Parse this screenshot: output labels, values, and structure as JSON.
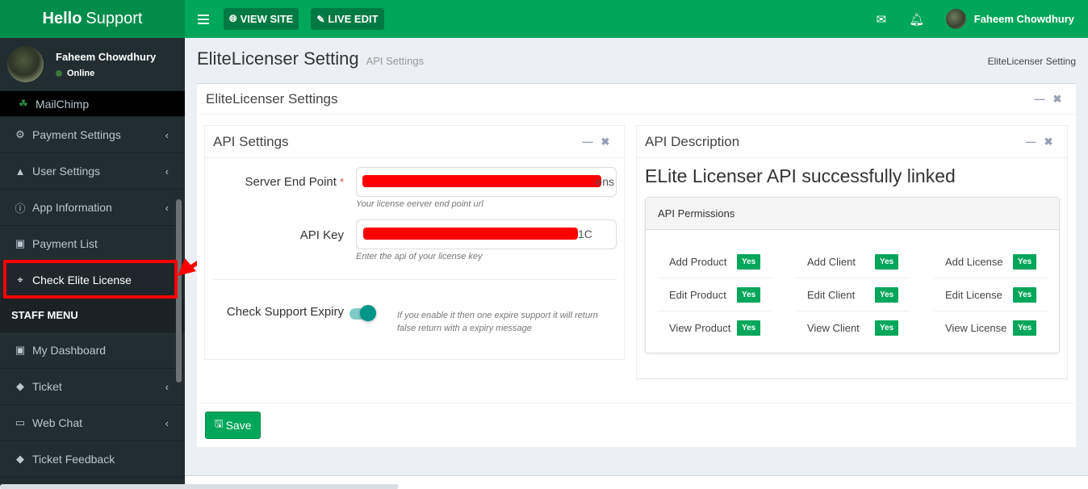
{
  "app": {
    "logo_bold": "Hello",
    "logo_rest": "Support"
  },
  "navbar": {
    "view_site": "VIEW SITE",
    "live_edit": "LIVE EDIT",
    "user_name": "Faheem Chowdhury",
    "icons": {
      "menu": "hamburger-icon",
      "globe": "globe-icon",
      "edit": "edit-icon",
      "mail": "envelope-icon",
      "bell": "bell-icon"
    }
  },
  "sidebar": {
    "user": {
      "name": "Faheem Chowdhury",
      "status": "Online"
    },
    "items": [
      {
        "label": "MailChimp",
        "icon": "mailchimp-icon"
      },
      {
        "label": "Payment Settings",
        "icon": "gear-icon",
        "has_children": true
      },
      {
        "label": "User Settings",
        "icon": "user-icon",
        "has_children": true
      },
      {
        "label": "App Information",
        "icon": "info-icon",
        "has_children": true
      },
      {
        "label": "Payment List",
        "icon": "money-icon"
      },
      {
        "label": "Check Elite License",
        "icon": "crosshair-icon",
        "active": true
      }
    ],
    "staff_header": "STAFF MENU",
    "staff_items": [
      {
        "label": "My Dashboard",
        "icon": "dashboard-icon"
      },
      {
        "label": "Ticket",
        "icon": "ticket-icon",
        "has_children": true
      },
      {
        "label": "Web Chat",
        "icon": "chat-icon",
        "has_children": true
      },
      {
        "label": "Ticket Feedback",
        "icon": "ticket-icon"
      }
    ]
  },
  "content": {
    "title": "EliteLicenser Setting",
    "subtitle": "API Settings",
    "breadcrumb": "EliteLicenser Setting",
    "main_box_title": "EliteLicenser Settings",
    "api_settings": {
      "title": "API Settings",
      "server_end_point": {
        "label": "Server End Point",
        "required": "*",
        "visible_tail": "ens",
        "help": "Your license eerver end point url"
      },
      "api_key": {
        "label": "API Key",
        "visible_tail": "1C",
        "help": "Enter the api of your license key"
      },
      "support_expiry": {
        "label": "Check Support Expiry",
        "enabled": true,
        "help": "If you enable it then one expire support it will return false return with a expiry message"
      }
    },
    "api_description": {
      "title": "API Description",
      "status_message": "ELite Licenser API successfully linked",
      "permissions_title": "API Permissions",
      "permissions": [
        {
          "label": "Add Product",
          "value": "Yes"
        },
        {
          "label": "Add Client",
          "value": "Yes"
        },
        {
          "label": "Add License",
          "value": "Yes"
        },
        {
          "label": "Edit Product",
          "value": "Yes"
        },
        {
          "label": "Edit Client",
          "value": "Yes"
        },
        {
          "label": "Edit License",
          "value": "Yes"
        },
        {
          "label": "View Product",
          "value": "Yes"
        },
        {
          "label": "View Client",
          "value": "Yes"
        },
        {
          "label": "View License",
          "value": "Yes"
        }
      ]
    },
    "save_label": "Save"
  },
  "colors": {
    "brand": "#00a65a",
    "brand_dark": "#008d4c",
    "sidebar": "#222d32",
    "annotation": "#ff0000",
    "toggle": "#009688"
  }
}
